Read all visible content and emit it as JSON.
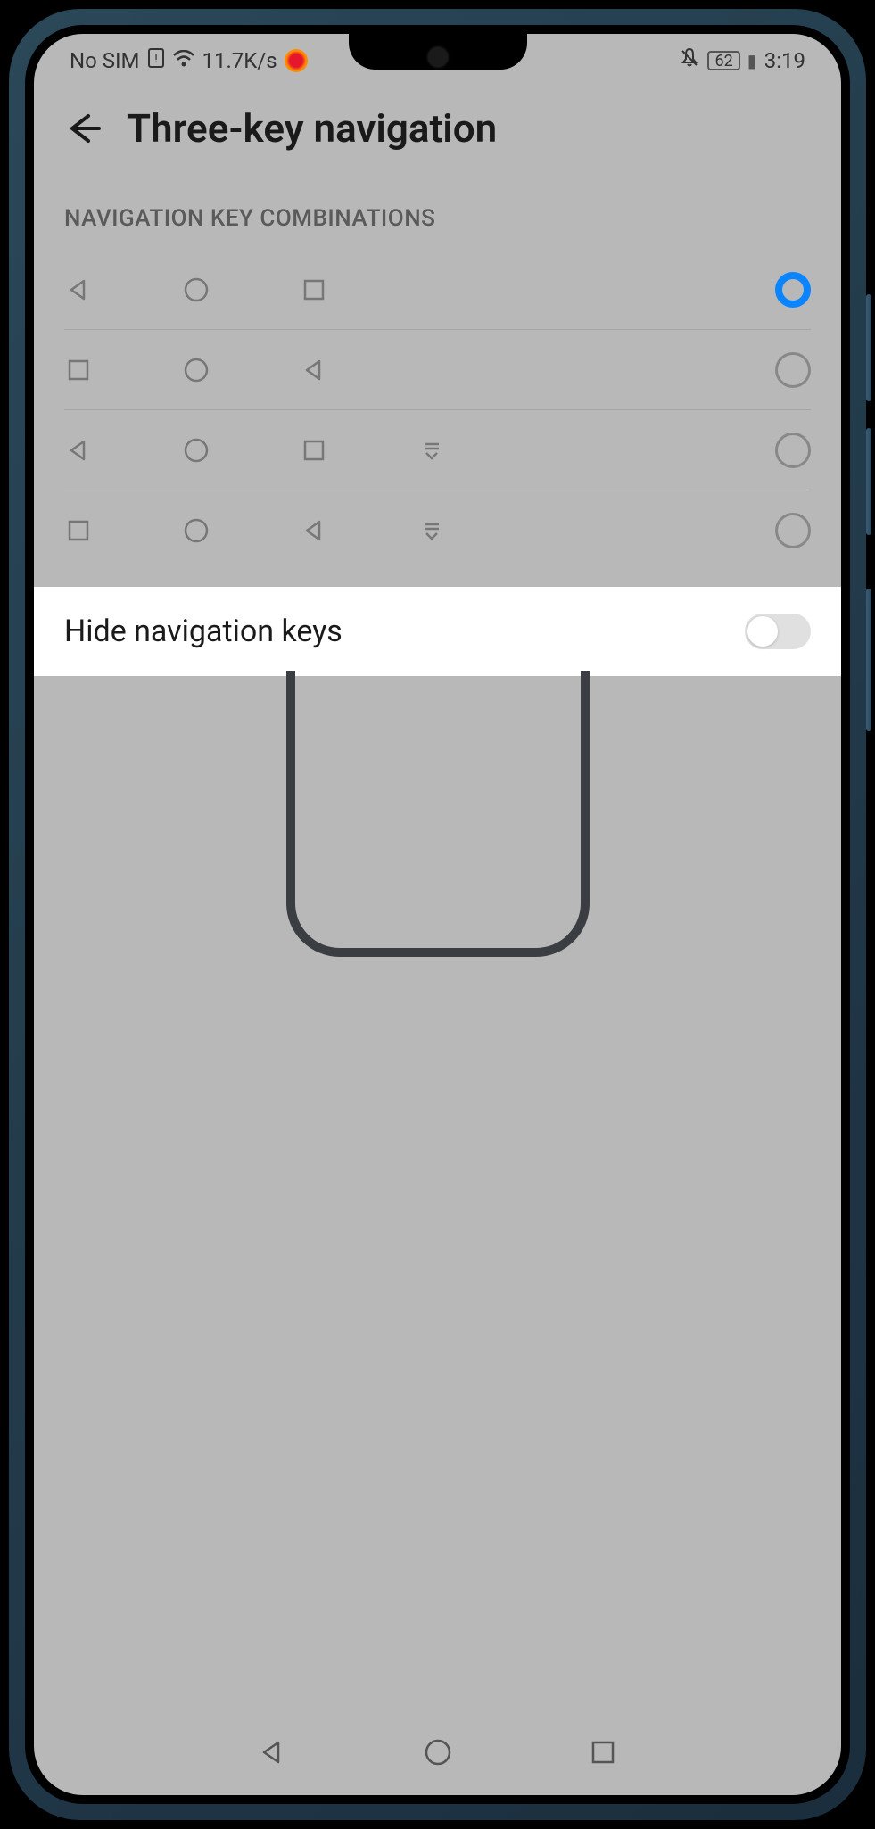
{
  "status": {
    "sim": "No SIM",
    "speed": "11.7K/s",
    "battery": "62",
    "time": "3:19"
  },
  "header": {
    "title": "Three-key navigation"
  },
  "section": {
    "label": "NAVIGATION KEY COMBINATIONS"
  },
  "options": [
    {
      "keys": [
        "back",
        "home",
        "recent"
      ],
      "hasDropdown": false,
      "selected": true
    },
    {
      "keys": [
        "recent",
        "home",
        "back"
      ],
      "hasDropdown": false,
      "selected": false
    },
    {
      "keys": [
        "back",
        "home",
        "recent",
        "dropdown"
      ],
      "hasDropdown": true,
      "selected": false
    },
    {
      "keys": [
        "recent",
        "home",
        "back",
        "dropdown"
      ],
      "hasDropdown": true,
      "selected": false
    }
  ],
  "hideNav": {
    "label": "Hide navigation keys",
    "enabled": false
  }
}
